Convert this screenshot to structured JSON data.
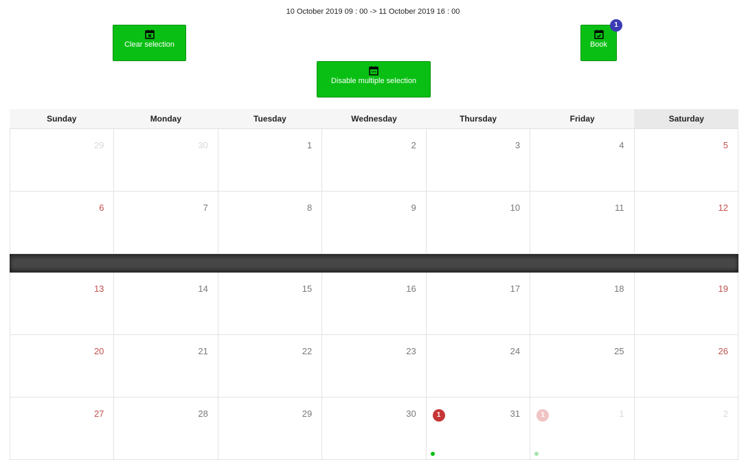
{
  "header": {
    "range_text": "10 October 2019 09 : 00 -> 11 October 2019 16 : 00"
  },
  "buttons": {
    "clear_label": "Clear selection",
    "book_label": "Book",
    "book_badge": "1",
    "multi_label": "Disable multiple selection"
  },
  "colors": {
    "button_green": "#0abf14",
    "badge_blue": "#3b3bb5",
    "weekend_red": "#c0504d",
    "event_red": "#c63636"
  },
  "calendar": {
    "weekdays": [
      "Sunday",
      "Monday",
      "Tuesday",
      "Wednesday",
      "Thursday",
      "Friday",
      "Saturday"
    ],
    "weeks": [
      [
        "29",
        "30",
        "1",
        "2",
        "3",
        "4",
        "5"
      ],
      [
        "6",
        "7",
        "8",
        "9",
        "10",
        "11",
        "12"
      ],
      [
        "13",
        "14",
        "15",
        "16",
        "17",
        "18",
        "19"
      ],
      [
        "20",
        "21",
        "22",
        "23",
        "24",
        "25",
        "26"
      ],
      [
        "27",
        "28",
        "29",
        "30",
        "31",
        "1",
        "2"
      ]
    ],
    "events": {
      "thursday_31": "1",
      "friday_1": "1"
    }
  }
}
